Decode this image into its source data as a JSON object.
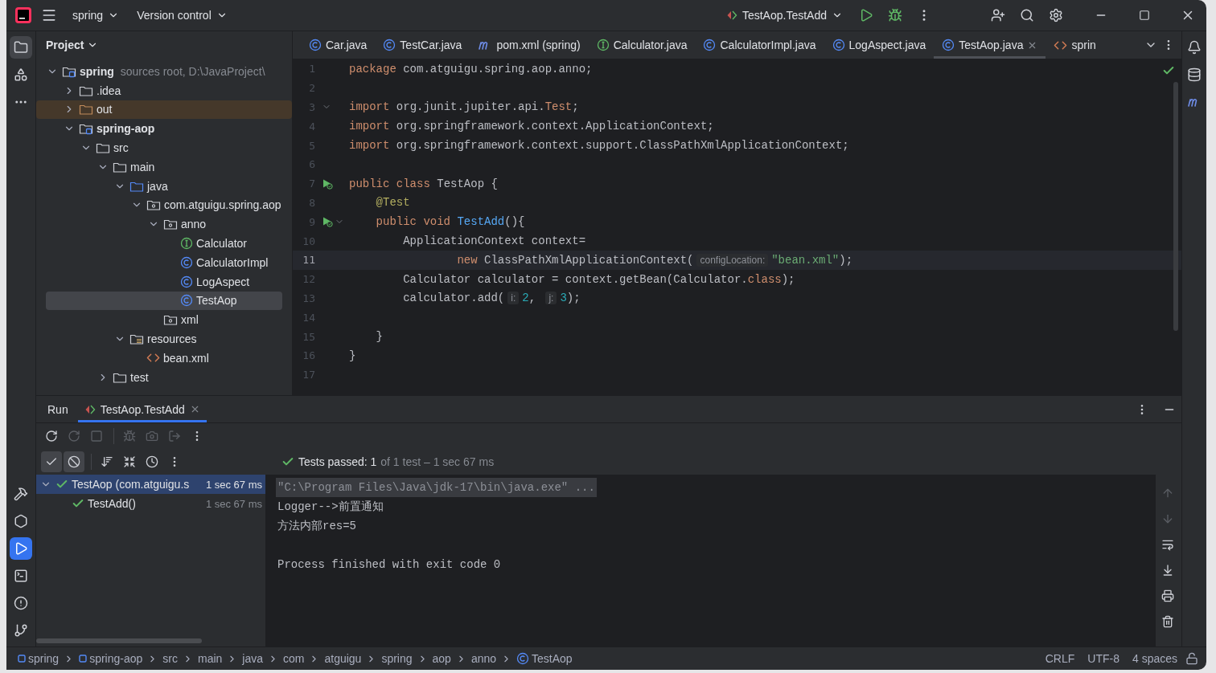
{
  "title_bar": {
    "project": "spring",
    "vcs": "Version control",
    "run_config": "TestAop.TestAdd"
  },
  "left_tools": [
    {
      "kind": "project",
      "selected": true
    },
    {
      "kind": "structure",
      "selected": false
    },
    {
      "kind": "more",
      "selected": false
    }
  ],
  "left_tools_bottom": [
    {
      "kind": "build",
      "selected": false
    },
    {
      "kind": "services",
      "selected": false
    },
    {
      "kind": "run",
      "selected": true
    },
    {
      "kind": "terminal",
      "selected": false
    },
    {
      "kind": "problems",
      "selected": false
    },
    {
      "kind": "git",
      "selected": false
    }
  ],
  "project_panel": {
    "title": "Project"
  },
  "project_tree": [
    {
      "label": "spring",
      "kind": "module",
      "hint": "sources root,  D:\\JavaProject\\",
      "expanded": true,
      "selected": false,
      "children": [
        {
          "label": ".idea",
          "kind": "folder",
          "expanded": false,
          "selected": false
        },
        {
          "label": "out",
          "kind": "folder",
          "expanded": false,
          "excluded": true,
          "selected": false
        },
        {
          "label": "spring-aop",
          "kind": "module",
          "expanded": true,
          "selected": false,
          "children": [
            {
              "label": "src",
              "kind": "folder",
              "expanded": true,
              "selected": false,
              "children": [
                {
                  "label": "main",
                  "kind": "folder",
                  "expanded": true,
                  "selected": false,
                  "children": [
                    {
                      "label": "java",
                      "kind": "source",
                      "expanded": true,
                      "selected": false,
                      "children": [
                        {
                          "label": "com.atguigu.spring.aop",
                          "kind": "package",
                          "expanded": true,
                          "selected": false,
                          "children": [
                            {
                              "label": "anno",
                              "kind": "package",
                              "expanded": true,
                              "selected": false,
                              "children": [
                                {
                                  "label": "Calculator",
                                  "kind": "interface",
                                  "selected": false
                                },
                                {
                                  "label": "CalculatorImpl",
                                  "kind": "class",
                                  "selected": false
                                },
                                {
                                  "label": "LogAspect",
                                  "kind": "class",
                                  "selected": false
                                },
                                {
                                  "label": "TestAop",
                                  "kind": "class",
                                  "selected": true
                                }
                              ]
                            },
                            {
                              "label": "xml",
                              "kind": "package",
                              "selected": false
                            }
                          ]
                        }
                      ]
                    },
                    {
                      "label": "resources",
                      "kind": "resources",
                      "expanded": true,
                      "selected": false,
                      "children": [
                        {
                          "label": "bean.xml",
                          "kind": "xml",
                          "selected": false
                        }
                      ]
                    }
                  ]
                },
                {
                  "label": "test",
                  "kind": "folder",
                  "expanded": false,
                  "selected": false
                }
              ]
            }
          ]
        }
      ]
    }
  ],
  "editor_tabs": [
    {
      "label": "Car.java",
      "kind": "class",
      "selected": false
    },
    {
      "label": "TestCar.java",
      "kind": "class",
      "selected": false
    },
    {
      "label": "pom.xml (spring)",
      "kind": "maven",
      "selected": false
    },
    {
      "label": "Calculator.java",
      "kind": "interface",
      "selected": false
    },
    {
      "label": "CalculatorImpl.java",
      "kind": "class",
      "selected": false
    },
    {
      "label": "LogAspect.java",
      "kind": "class",
      "selected": false
    },
    {
      "label": "TestAop.java",
      "kind": "class",
      "selected": true
    },
    {
      "label": "sprin",
      "kind": "xml",
      "selected": false
    }
  ],
  "code_lines": [
    {
      "number": "1",
      "tokens": [
        {
          "kind": "keyword",
          "text": "package"
        },
        {
          "kind": "plain",
          "text": " com.atguigu.spring.aop.anno;"
        }
      ]
    },
    {
      "number": "2"
    },
    {
      "number": "3",
      "fold": true,
      "tokens": [
        {
          "kind": "keyword",
          "text": "import"
        },
        {
          "kind": "plain",
          "text": " org.junit.jupiter.api."
        },
        {
          "kind": "keyword",
          "text": "Test"
        },
        {
          "kind": "plain",
          "text": ";"
        }
      ]
    },
    {
      "number": "4",
      "tokens": [
        {
          "kind": "keyword",
          "text": "import"
        },
        {
          "kind": "plain",
          "text": " org.springframework.context.ApplicationContext;"
        }
      ]
    },
    {
      "number": "5",
      "tokens": [
        {
          "kind": "keyword",
          "text": "import"
        },
        {
          "kind": "plain",
          "text": " org.springframework.context.support.ClassPathXmlApplicationContext;"
        }
      ]
    },
    {
      "number": "6"
    },
    {
      "number": "7",
      "run_marker": true,
      "tokens": [
        {
          "kind": "keyword",
          "text": "public class"
        },
        {
          "kind": "plain",
          "text": " TestAop {"
        }
      ]
    },
    {
      "number": "8",
      "tokens": [
        {
          "kind": "annotation",
          "text": "    @Test"
        }
      ]
    },
    {
      "number": "9",
      "run_marker": true,
      "fold": true,
      "tokens": [
        {
          "kind": "keyword",
          "text": "    public void"
        },
        {
          "kind": "method",
          "text": " TestAdd"
        },
        {
          "kind": "plain",
          "text": "(){"
        }
      ]
    },
    {
      "number": "10",
      "tokens": [
        {
          "kind": "plain",
          "text": "        ApplicationContext context="
        }
      ]
    },
    {
      "number": "11",
      "current": true,
      "tokens": [
        {
          "kind": "keyword",
          "text": "                new"
        },
        {
          "kind": "plain",
          "text": " ClassPathXmlApplicationContext("
        },
        {
          "kind": "hint",
          "text": "configLocation:"
        },
        {
          "kind": "string",
          "text": "\"bean.xml\""
        },
        {
          "kind": "plain",
          "text": ");"
        }
      ]
    },
    {
      "number": "12",
      "tokens": [
        {
          "kind": "plain",
          "text": "        Calculator calculator = context.getBean(Calculator."
        },
        {
          "kind": "keyword",
          "text": "class"
        },
        {
          "kind": "plain",
          "text": ");"
        }
      ]
    },
    {
      "number": "13",
      "tokens": [
        {
          "kind": "plain",
          "text": "        calculator.add("
        },
        {
          "kind": "hint",
          "text": "i:"
        },
        {
          "kind": "number",
          "text": "2"
        },
        {
          "kind": "plain",
          "text": ", "
        },
        {
          "kind": "hint",
          "text": "j:"
        },
        {
          "kind": "number",
          "text": "3"
        },
        {
          "kind": "plain",
          "text": ");"
        }
      ]
    },
    {
      "number": "14"
    },
    {
      "number": "15",
      "tokens": [
        {
          "kind": "plain",
          "text": "    }"
        }
      ]
    },
    {
      "number": "16",
      "tokens": [
        {
          "kind": "plain",
          "text": "}"
        }
      ]
    },
    {
      "number": "17"
    }
  ],
  "right_tools": [
    {
      "kind": "notifications"
    },
    {
      "kind": "database"
    },
    {
      "kind": "maven"
    }
  ],
  "run_panel": {
    "tabs": [
      {
        "label": "Run",
        "kind": "plain",
        "selected": false
      },
      {
        "label": "TestAop.TestAdd",
        "kind": "test",
        "selected": true
      }
    ],
    "toolbar": [
      {
        "kind": "rerun",
        "disabled": false
      },
      {
        "kind": "rerun-failed",
        "disabled": true
      },
      {
        "kind": "stop",
        "disabled": true
      },
      {
        "kind": "debug",
        "disabled": true
      },
      {
        "kind": "snapshot",
        "disabled": true
      },
      {
        "kind": "exit",
        "disabled": true
      },
      {
        "kind": "more",
        "disabled": false
      }
    ],
    "filters": [
      {
        "kind": "show-passed",
        "selected": true
      },
      {
        "kind": "show-ignored",
        "selected": true
      },
      {
        "kind": "sort"
      },
      {
        "kind": "collapse"
      },
      {
        "kind": "history"
      },
      {
        "kind": "more"
      }
    ],
    "summary": {
      "label": "Tests passed: 1",
      "detail": "of 1 test – 1 sec 67 ms"
    },
    "tests": [
      {
        "name": "TestAop (com.atguigu.s",
        "time": "1 sec 67 ms",
        "passed": true,
        "expanded": true,
        "selected": true,
        "children": [
          {
            "name": "TestAdd()",
            "time": "1 sec 67 ms",
            "passed": true,
            "selected": false
          }
        ]
      }
    ],
    "console": [
      {
        "kind": "command",
        "text": "\"C:\\Program Files\\Java\\jdk-17\\bin\\java.exe\" ..."
      },
      {
        "kind": "output",
        "text": "Logger-->前置通知"
      },
      {
        "kind": "output",
        "text": "方法内部res=5"
      },
      {
        "kind": "blank"
      },
      {
        "kind": "output",
        "text": "Process finished with exit code 0"
      }
    ],
    "console_actions": [
      {
        "kind": "up",
        "disabled": true
      },
      {
        "kind": "down",
        "disabled": true
      },
      {
        "kind": "wrap",
        "disabled": false
      },
      {
        "kind": "scroll-end",
        "disabled": false
      },
      {
        "kind": "print",
        "disabled": false
      },
      {
        "kind": "clear",
        "disabled": false
      }
    ]
  },
  "breadcrumbs": [
    {
      "label": "spring",
      "kind": "module"
    },
    {
      "label": "spring-aop",
      "kind": "module"
    },
    {
      "label": "src",
      "kind": "plain"
    },
    {
      "label": "main",
      "kind": "plain"
    },
    {
      "label": "java",
      "kind": "plain"
    },
    {
      "label": "com",
      "kind": "plain"
    },
    {
      "label": "atguigu",
      "kind": "plain"
    },
    {
      "label": "spring",
      "kind": "plain"
    },
    {
      "label": "aop",
      "kind": "plain"
    },
    {
      "label": "anno",
      "kind": "plain"
    },
    {
      "label": "TestAop",
      "kind": "class"
    }
  ],
  "status_items": [
    "CRLF",
    "UTF-8",
    "4 spaces"
  ]
}
